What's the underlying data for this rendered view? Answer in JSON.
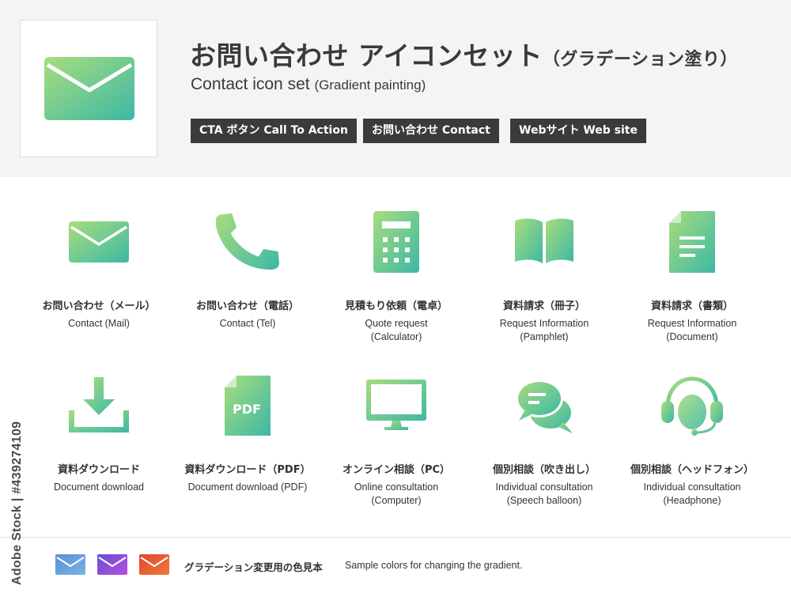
{
  "header": {
    "title_main": "お問い合わせ アイコンセット",
    "title_sub": "（グラデーション塗り）",
    "subtitle_main": "Contact icon set",
    "subtitle_sub": "(Gradient painting)",
    "hero_icon": "mail-icon",
    "tags": [
      "CTA ボタン Call To Action",
      "お問い合わせ Contact",
      "Webサイト Web site"
    ]
  },
  "gradient": {
    "start": "#a8dd7c",
    "end": "#3db8a5"
  },
  "icons": [
    {
      "icon": "mail-icon",
      "jp": "お問い合わせ（メール）",
      "en": "Contact (Mail)"
    },
    {
      "icon": "phone-icon",
      "jp": "お問い合わせ（電話）",
      "en": "Contact (Tel)"
    },
    {
      "icon": "calculator-icon",
      "jp": "見積もり依頼（電卓）",
      "en": "Quote request\n(Calculator)"
    },
    {
      "icon": "book-icon",
      "jp": "資料請求（冊子）",
      "en": "Request Information\n(Pamphlet)"
    },
    {
      "icon": "document-icon",
      "jp": "資料請求（書類）",
      "en": "Request Information\n(Document)"
    },
    {
      "icon": "download-icon",
      "jp": "資料ダウンロード",
      "en": "Document download"
    },
    {
      "icon": "pdf-icon",
      "jp": "資料ダウンロード（PDF）",
      "en": "Document download (PDF)",
      "glyph_text": "PDF"
    },
    {
      "icon": "monitor-icon",
      "jp": "オンライン相談（PC）",
      "en": "Online consultation\n(Computer)"
    },
    {
      "icon": "speech-bubble-icon",
      "jp": "個別相談（吹き出し）",
      "en": "Individual consultation\n(Speech balloon)"
    },
    {
      "icon": "headset-icon",
      "jp": "個別相談（ヘッドフォン）",
      "en": "Individual consultation\n(Headphone)"
    }
  ],
  "samples": {
    "jp": "グラデーション変更用の色見本",
    "en": "Sample colors for changing the gradient.",
    "swatches": [
      {
        "icon": "mail-icon",
        "start": "#5b8fd4",
        "end": "#79b4e8"
      },
      {
        "icon": "mail-icon",
        "start": "#6a4fd0",
        "end": "#b44fe0"
      },
      {
        "icon": "mail-icon",
        "start": "#e0452c",
        "end": "#f07a3a"
      }
    ]
  },
  "stock_id": "Adobe Stock | #439274109"
}
